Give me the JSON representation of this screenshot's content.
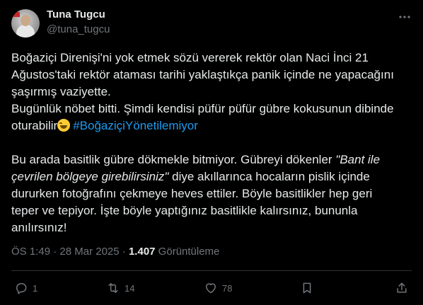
{
  "author": {
    "name": "Tuna Tugcu",
    "handle": "@tuna_tugcu"
  },
  "tweet": {
    "line1": "Boğaziçi Direnişi'ni yok etmek sözü vererek rektör olan Naci İnci 21",
    "line2": "Ağustos'taki rektör ataması tarihi yaklaştıkça panik içinde ne yapacağını",
    "line3": "şaşırmış vaziyette.",
    "line4": "Bugünlük nöbet bitti. Şimdi kendisi püfür püfür gübre kokusunun dibinde",
    "line5_text": "oturabilir",
    "line5_emoji": "grinning-sweat-emoji",
    "line5_hashtag": "#BoğaziçiYönetilemiyor",
    "line6_pre": "Bu arada basitlik gübre dökmekle bitmiyor. Gübreyi dökenler ",
    "line6_italic": "\"Bant ile",
    "line7_italic": "çevrilen bölgeye girebilirsiniz\"",
    "line7_post": " diye akıllarınca hocaların pislik içinde",
    "line8": "dururken fotoğrafını çekmeye heves ettiler. Böyle basitlikler hep geri",
    "line9": "teper ve tepiyor. İşte böyle yaptığınız basitlikle kalırsınız, bununla",
    "line10": "anılırsınız!"
  },
  "meta": {
    "time": "ÖS 1:49",
    "sep1": " · ",
    "date": "28 Mar 2025",
    "sep2": " · ",
    "views_count": "1.407",
    "views_label": " Görüntüleme"
  },
  "actions": {
    "replies": "1",
    "retweets": "14",
    "likes": "78"
  },
  "colors": {
    "background": "#000000",
    "text": "#e7e9ea",
    "secondary": "#71767b",
    "link": "#1d9bf0",
    "divider": "#2f3336"
  }
}
